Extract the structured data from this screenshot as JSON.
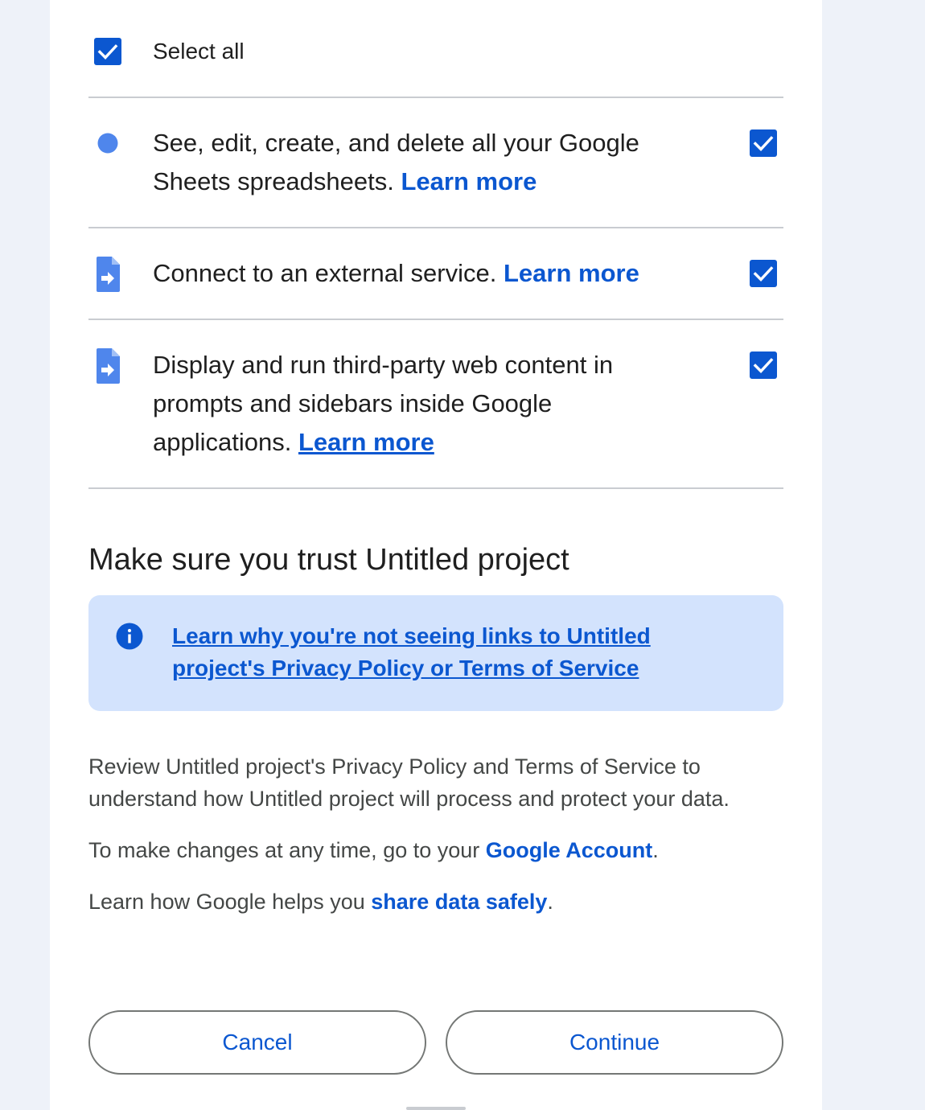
{
  "select_all": {
    "label": "Select all",
    "checked": true
  },
  "scopes": [
    {
      "text": "See, edit, create, and delete all your Google Sheets spreadsheets.",
      "link": "Learn more",
      "icon": "sheets-dot-icon",
      "checked": true
    },
    {
      "text": "Connect to an external service.",
      "link": "Learn more",
      "icon": "apps-script-file-icon",
      "checked": true
    },
    {
      "text": "Display and run third-party web content in prompts and sidebars inside Google applications.",
      "link": "Learn more",
      "icon": "apps-script-file-icon",
      "checked": true
    }
  ],
  "trust": {
    "title": "Make sure you trust Untitled project",
    "info_link": "Learn why you're not seeing links to Untitled project's Privacy Policy or Terms of Service"
  },
  "review_text": "Review Untitled project's Privacy Policy and Terms of Service to understand how Untitled project will process and protect your data.",
  "changes": {
    "prefix": "To make changes at any time, go to your",
    "link": "Google Account",
    "suffix": "."
  },
  "share": {
    "prefix": "Learn how Google helps you",
    "link": "share data safely",
    "suffix": "."
  },
  "buttons": {
    "cancel": "Cancel",
    "continue": "Continue"
  },
  "colors": {
    "accent": "#0b57d0",
    "info_bg": "#d3e3fd",
    "page_bg": "#eef2f9"
  }
}
